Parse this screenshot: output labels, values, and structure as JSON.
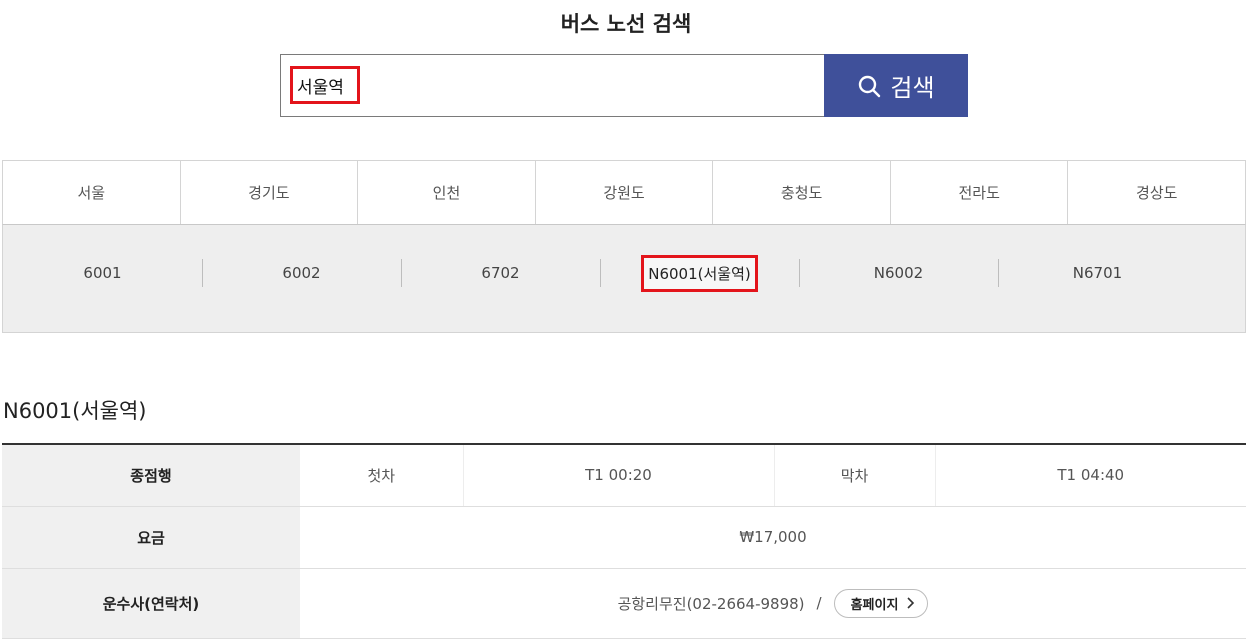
{
  "header": {
    "title": "버스 노선 검색"
  },
  "search": {
    "value": "서울역",
    "button_label": "검색",
    "button_icon": "search-icon"
  },
  "regions": [
    "서울",
    "경기도",
    "인천",
    "강원도",
    "충청도",
    "전라도",
    "경상도"
  ],
  "routes": [
    "6001",
    "6002",
    "6702",
    "N6001(서울역)",
    "N6002",
    "N6701"
  ],
  "selected_route": "N6001(서울역)",
  "detail": {
    "title": "N6001(서울역)",
    "destination_label": "종점행",
    "first_label": "첫차",
    "first_time": "T1 00:20",
    "last_label": "막차",
    "last_time": "T1 04:40",
    "fare_label": "요금",
    "fare": "₩17,000",
    "operator_label": "운수사(연락처)",
    "operator": "공항리무진(02-2664-9898)",
    "separator": "/",
    "homepage_label": "홈페이지"
  },
  "colors": {
    "accent": "#3f509a",
    "highlight": "#e3141b",
    "panel": "#eeeeee"
  }
}
